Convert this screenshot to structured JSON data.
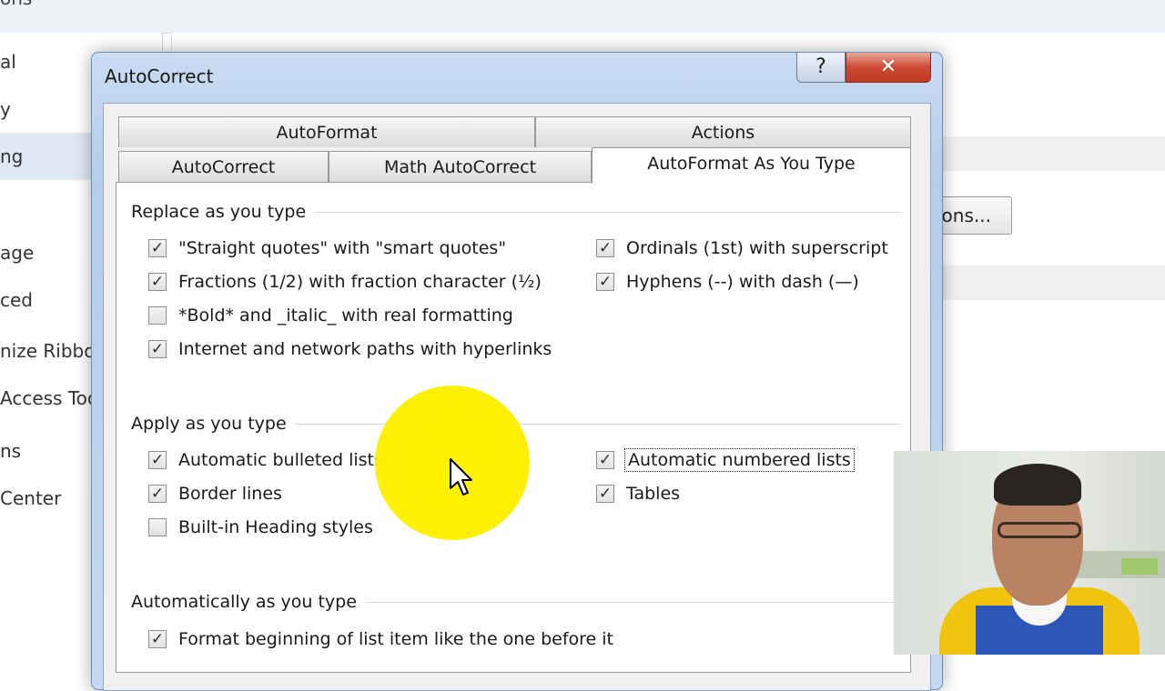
{
  "background": {
    "top_text": "ons",
    "sidebar_items": [
      {
        "label": "al",
        "selected": false
      },
      {
        "label": "y",
        "selected": false
      },
      {
        "label": "ng",
        "selected": true
      },
      {
        "label": "age",
        "selected": false
      },
      {
        "label": "ced",
        "selected": false
      },
      {
        "label": "nize Ribbon",
        "selected": false
      },
      {
        "label": "Access Too",
        "selected": false
      },
      {
        "label": "ns",
        "selected": false
      },
      {
        "label": "Center",
        "selected": false
      }
    ],
    "button_label": "ions..."
  },
  "dialog": {
    "title": "AutoCorrect",
    "help_label": "?",
    "close_label": "✕",
    "tabs_row1": [
      "AutoFormat",
      "Actions"
    ],
    "tabs_row2": [
      "AutoCorrect",
      "Math AutoCorrect",
      "AutoFormat As You Type"
    ],
    "active_tab": "AutoFormat As You Type",
    "groups": [
      {
        "label": "Replace as you type",
        "options": [
          {
            "label": "\"Straight quotes\" with \"smart quotes\"",
            "checked": true
          },
          {
            "label": "Fractions (1/2) with fraction character (½)",
            "checked": true
          },
          {
            "label": "*Bold* and _italic_ with real formatting",
            "checked": false
          },
          {
            "label": "Internet and network paths with hyperlinks",
            "checked": true
          },
          {
            "label": "Ordinals (1st) with superscript",
            "checked": true
          },
          {
            "label": "Hyphens (--) with dash (—)",
            "checked": true
          }
        ]
      },
      {
        "label": "Apply as you type",
        "options": [
          {
            "label": "Automatic bulleted lists",
            "checked": true
          },
          {
            "label": "Border lines",
            "checked": true
          },
          {
            "label": "Built-in Heading styles",
            "checked": false
          },
          {
            "label": "Automatic numbered lists",
            "checked": true
          },
          {
            "label": "Tables",
            "checked": true
          }
        ]
      },
      {
        "label": "Automatically as you type",
        "options": [
          {
            "label": "Format beginning of list item like the one before it",
            "checked": true
          }
        ]
      }
    ]
  },
  "check_glyph": "✓",
  "colors": {
    "dialog_frame": "#b6cde9",
    "close_button": "#c13a22",
    "highlight": "#fff200",
    "selected_sidebar": "#dfe9f6"
  }
}
